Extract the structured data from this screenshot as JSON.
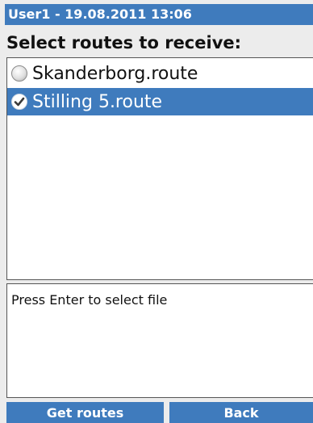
{
  "header": {
    "title": "User1 - 19.08.2011 13:06"
  },
  "heading": "Select routes to receive:",
  "routes": [
    {
      "label": "Skanderborg.route",
      "selected": false
    },
    {
      "label": "Stilling 5.route",
      "selected": true
    }
  ],
  "message": "Press Enter to select file",
  "softkeys": {
    "left": "Get routes",
    "right": "Back"
  },
  "colors": {
    "accent": "#3f7bbd",
    "background": "#ececec"
  }
}
